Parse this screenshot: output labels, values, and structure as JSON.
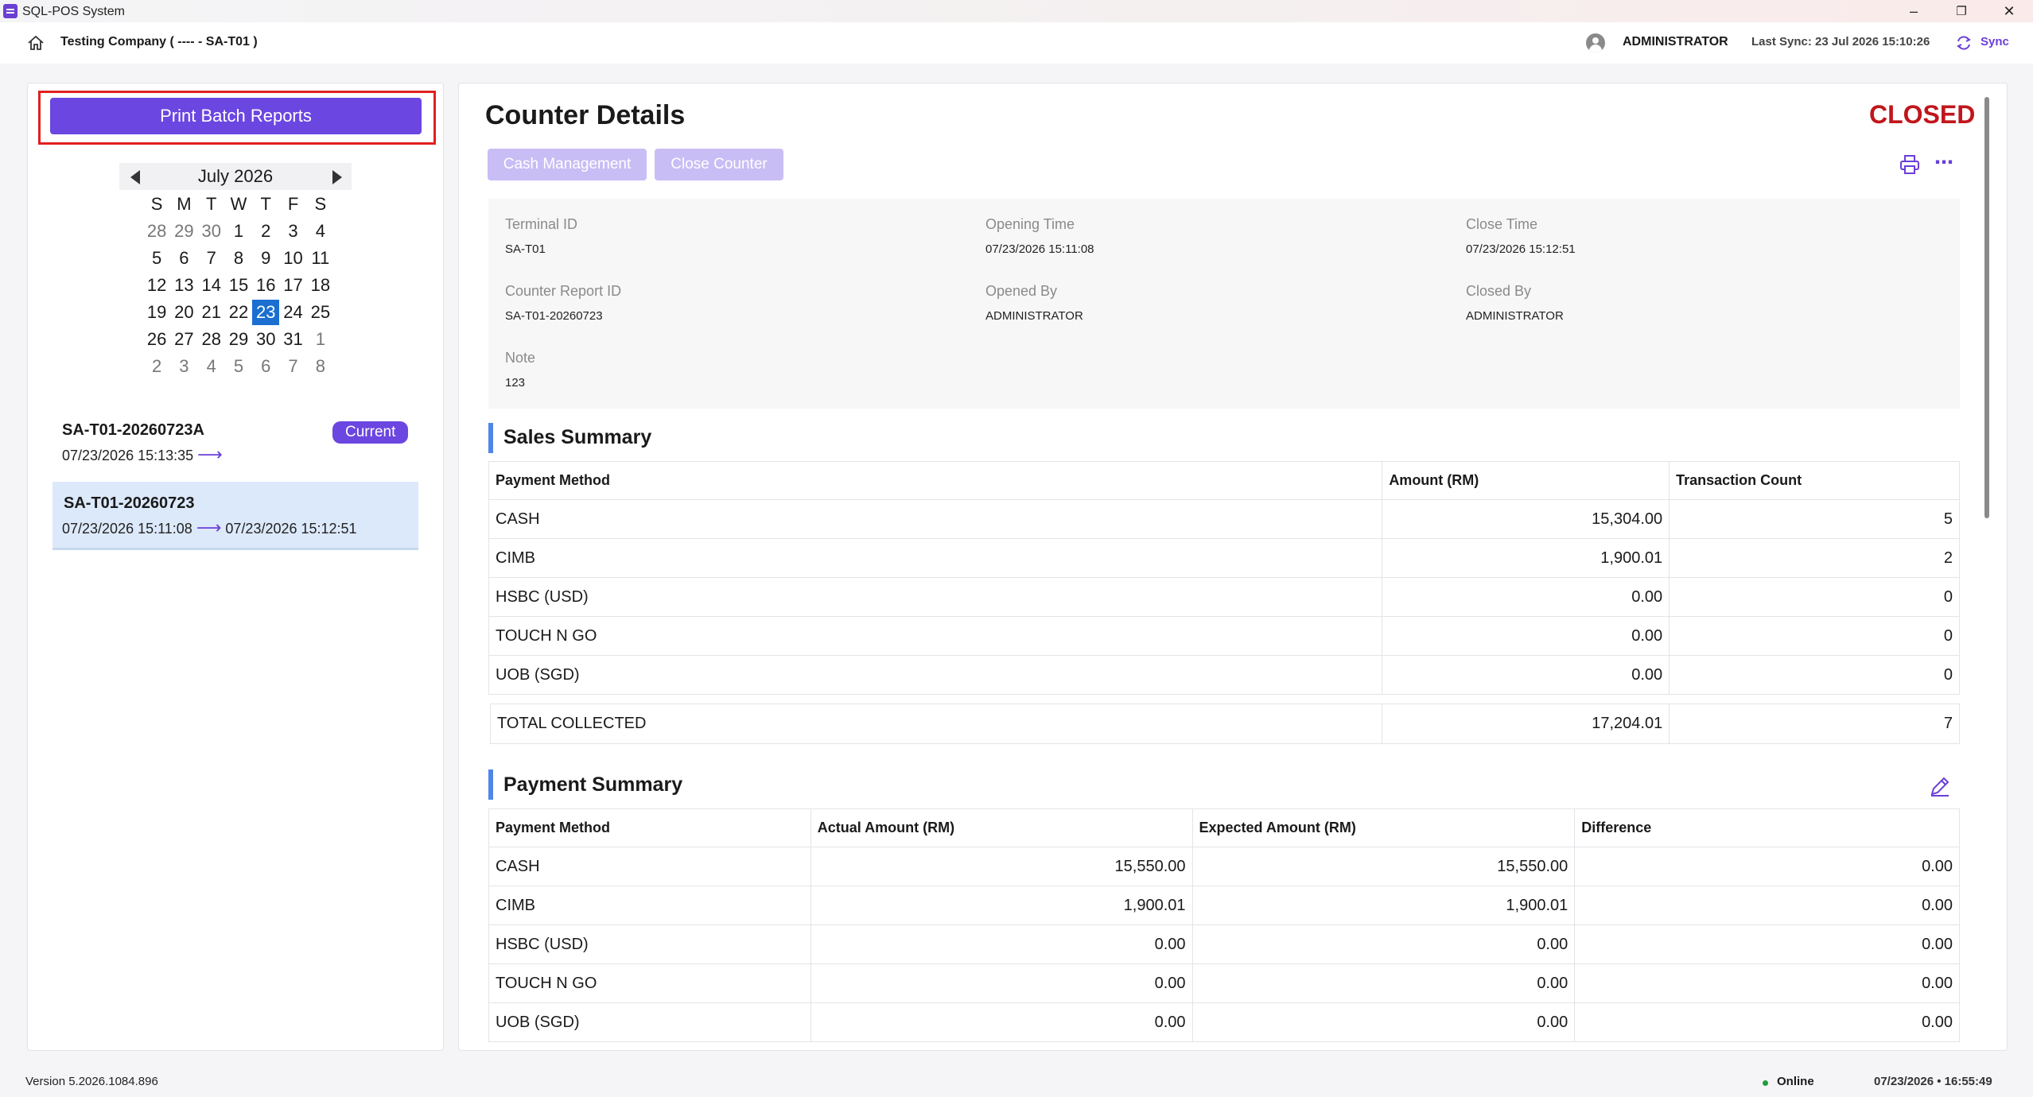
{
  "window": {
    "title": "SQL-POS System",
    "minimize": "–",
    "restore": "❐",
    "close": "✕"
  },
  "header": {
    "company": "Testing Company ( ---- - SA-T01 )",
    "user": "ADMINISTRATOR",
    "last_sync": "Last Sync: 23 Jul 2026 15:10:26",
    "sync_label": "Sync"
  },
  "sidebar": {
    "print_batch_label": "Print Batch Reports",
    "calendar": {
      "month_label": "July 2026",
      "weekdays": [
        "S",
        "M",
        "T",
        "W",
        "T",
        "F",
        "S"
      ],
      "weeks": [
        [
          {
            "d": "28",
            "dim": true
          },
          {
            "d": "29",
            "dim": true
          },
          {
            "d": "30",
            "dim": true
          },
          {
            "d": "1"
          },
          {
            "d": "2"
          },
          {
            "d": "3"
          },
          {
            "d": "4"
          }
        ],
        [
          {
            "d": "5"
          },
          {
            "d": "6"
          },
          {
            "d": "7"
          },
          {
            "d": "8"
          },
          {
            "d": "9"
          },
          {
            "d": "10"
          },
          {
            "d": "11"
          }
        ],
        [
          {
            "d": "12"
          },
          {
            "d": "13"
          },
          {
            "d": "14"
          },
          {
            "d": "15"
          },
          {
            "d": "16"
          },
          {
            "d": "17"
          },
          {
            "d": "18"
          }
        ],
        [
          {
            "d": "19"
          },
          {
            "d": "20"
          },
          {
            "d": "21"
          },
          {
            "d": "22"
          },
          {
            "d": "23",
            "sel": true
          },
          {
            "d": "24"
          },
          {
            "d": "25"
          }
        ],
        [
          {
            "d": "26"
          },
          {
            "d": "27"
          },
          {
            "d": "28"
          },
          {
            "d": "29"
          },
          {
            "d": "30"
          },
          {
            "d": "31"
          },
          {
            "d": "1",
            "dim": true
          }
        ],
        [
          {
            "d": "2",
            "dim": true
          },
          {
            "d": "3",
            "dim": true
          },
          {
            "d": "4",
            "dim": true
          },
          {
            "d": "5",
            "dim": true
          },
          {
            "d": "6",
            "dim": true
          },
          {
            "d": "7",
            "dim": true
          },
          {
            "d": "8",
            "dim": true
          }
        ]
      ]
    },
    "counters": [
      {
        "id": "SA-T01-20260723A",
        "open": "07/23/2026 15:13:35",
        "close": "",
        "badge": "Current"
      },
      {
        "id": "SA-T01-20260723",
        "open": "07/23/2026 15:11:08",
        "close": "07/23/2026 15:12:51"
      }
    ]
  },
  "main": {
    "title": "Counter Details",
    "status": "CLOSED",
    "cash_management_label": "Cash Management",
    "close_counter_label": "Close Counter",
    "details": {
      "terminal_id_label": "Terminal ID",
      "terminal_id": "SA-T01",
      "opening_time_label": "Opening Time",
      "opening_time": "07/23/2026 15:11:08",
      "close_time_label": "Close Time",
      "close_time": "07/23/2026 15:12:51",
      "report_id_label": "Counter Report ID",
      "report_id": "SA-T01-20260723",
      "opened_by_label": "Opened By",
      "opened_by": "ADMINISTRATOR",
      "closed_by_label": "Closed By",
      "closed_by": "ADMINISTRATOR",
      "note_label": "Note",
      "note": "123"
    },
    "sales_summary": {
      "title": "Sales Summary",
      "columns": [
        "Payment Method",
        "Amount (RM)",
        "Transaction Count"
      ],
      "rows": [
        [
          "CASH",
          "15,304.00",
          "5"
        ],
        [
          "CIMB",
          "1,900.01",
          "2"
        ],
        [
          "HSBC (USD)",
          "0.00",
          "0"
        ],
        [
          "TOUCH N GO",
          "0.00",
          "0"
        ],
        [
          "UOB (SGD)",
          "0.00",
          "0"
        ]
      ],
      "total": [
        "TOTAL COLLECTED",
        "17,204.01",
        "7"
      ]
    },
    "payment_summary": {
      "title": "Payment Summary",
      "columns": [
        "Payment Method",
        "Actual Amount (RM)",
        "Expected Amount (RM)",
        "Difference"
      ],
      "rows": [
        [
          "CASH",
          "15,550.00",
          "15,550.00",
          "0.00"
        ],
        [
          "CIMB",
          "1,900.01",
          "1,900.01",
          "0.00"
        ],
        [
          "HSBC (USD)",
          "0.00",
          "0.00",
          "0.00"
        ],
        [
          "TOUCH N GO",
          "0.00",
          "0.00",
          "0.00"
        ],
        [
          "UOB (SGD)",
          "0.00",
          "0.00",
          "0.00"
        ]
      ]
    }
  },
  "footer": {
    "version": "Version 5.2026.1084.896",
    "status": "Online",
    "datetime": "07/23/2026 • 16:55:49"
  },
  "icons": {
    "home": "home-icon",
    "user": "user-avatar-icon",
    "sync": "sync-icon",
    "print": "printer-icon",
    "more": "more-horizontal-icon",
    "edit": "pencil-icon"
  },
  "colors": {
    "accent": "#6b46e0",
    "closed": "#c0161c",
    "selected_day": "#1a6fd0",
    "section_bar": "#4f86e8"
  }
}
